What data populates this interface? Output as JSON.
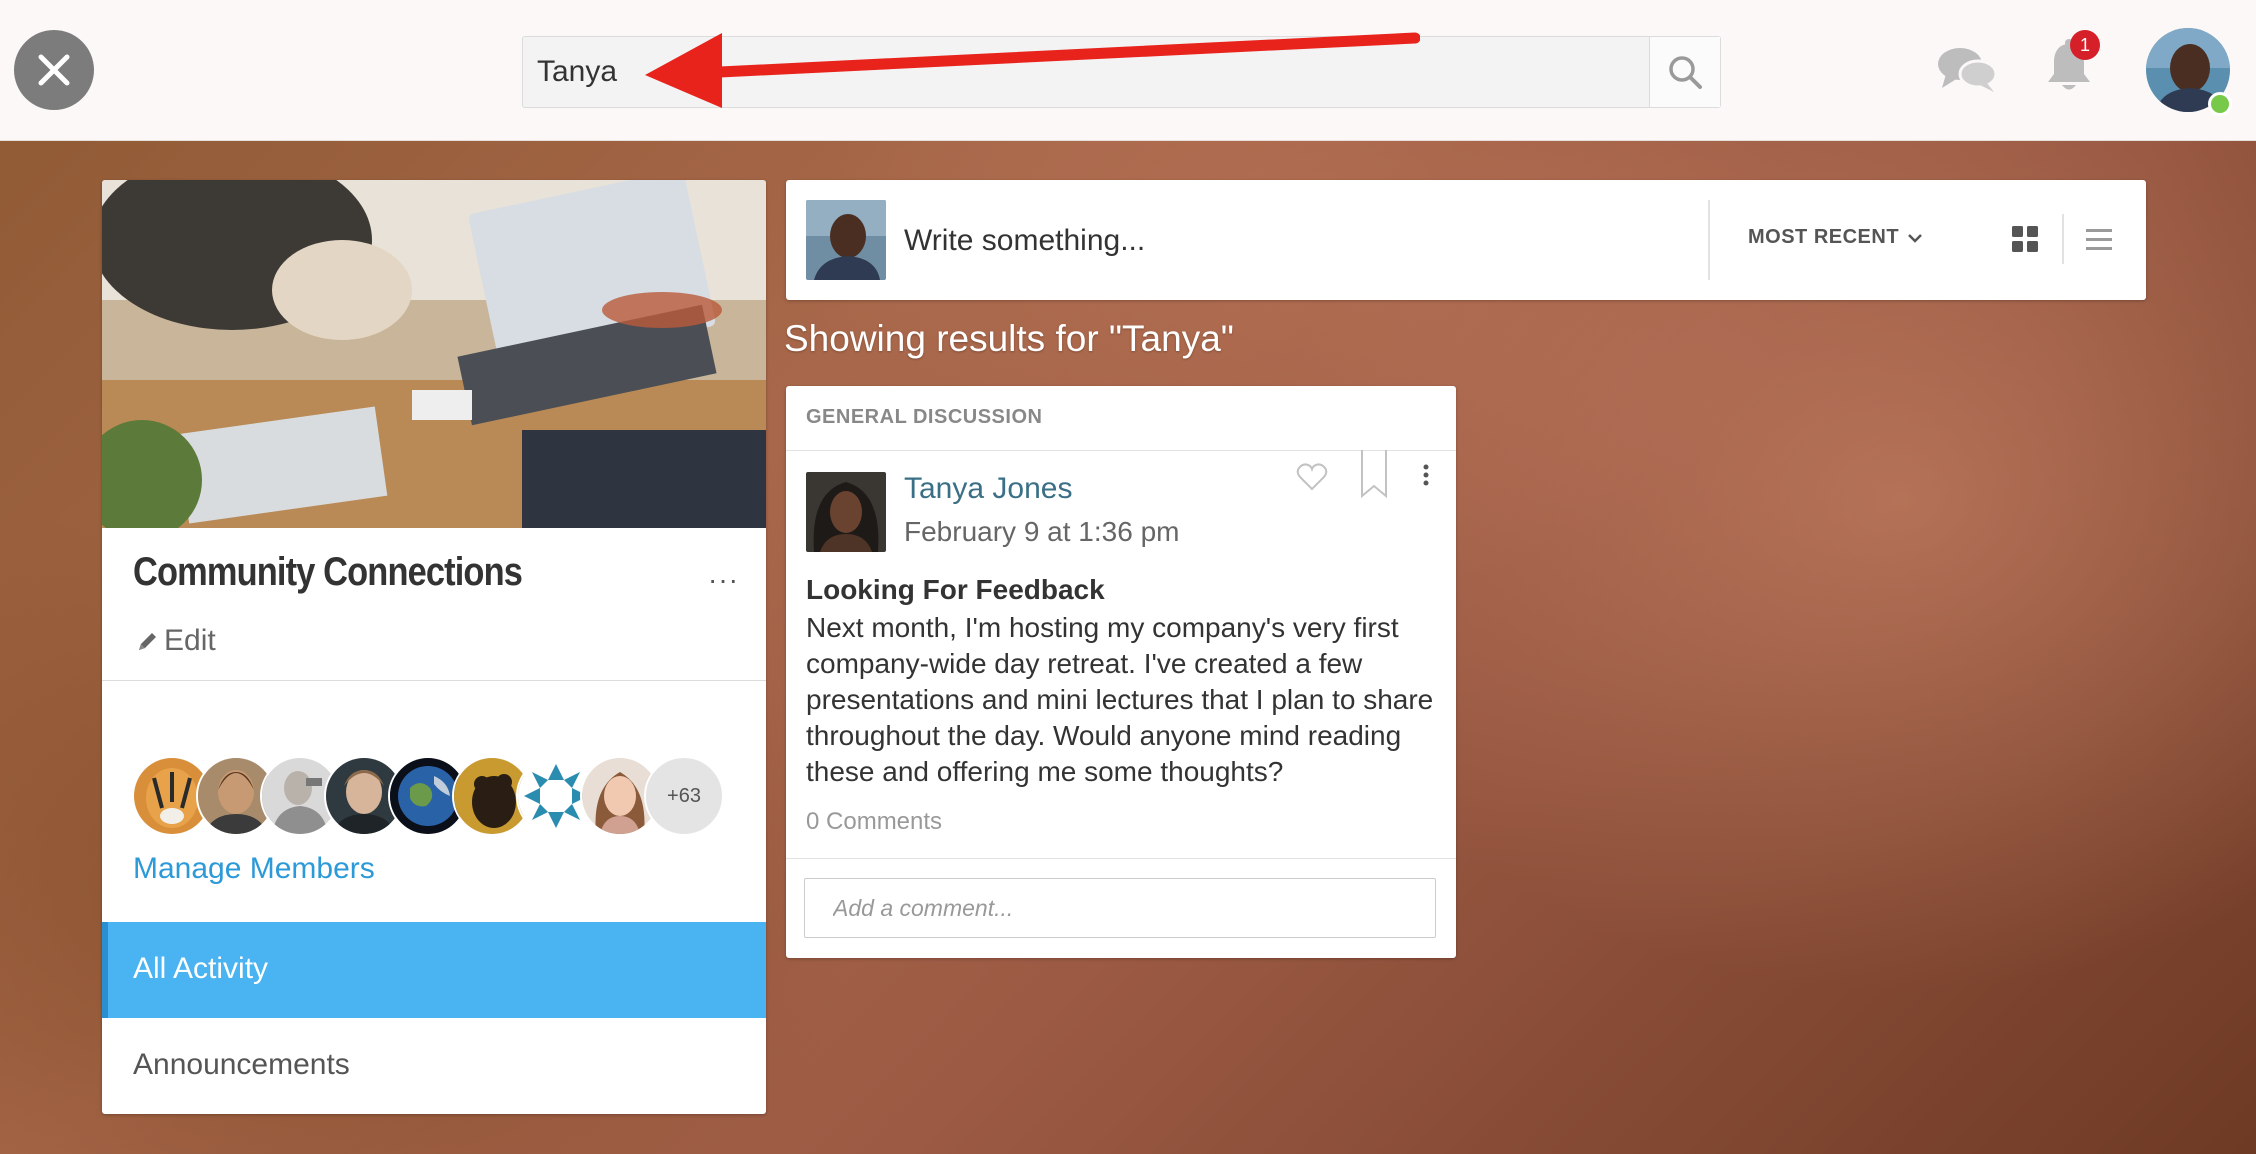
{
  "search": {
    "value": "Tanya"
  },
  "notifications": {
    "count": "1"
  },
  "group": {
    "title": "Community Connections",
    "more": "···",
    "edit_label": "Edit",
    "members_more": "+63",
    "manage_members": "Manage Members"
  },
  "nav": {
    "items": [
      {
        "label": "All Activity",
        "active": true
      },
      {
        "label": "Announcements",
        "active": false
      }
    ]
  },
  "composer": {
    "placeholder": "Write something...",
    "sort_label": "MOST RECENT"
  },
  "results": {
    "heading": "Showing results for \"Tanya\""
  },
  "post": {
    "category": "GENERAL DISCUSSION",
    "author": "Tanya Jones",
    "date": "February 9 at 1:36 pm",
    "title": "Looking For Feedback",
    "body": "Next month, I'm hosting my company's very first company-wide day retreat. I've created a few presentations and mini lectures that I plan to share throughout the day. Would anyone mind reading these and offering me some thoughts?",
    "comments": "0 Comments",
    "comment_placeholder": "Add a comment..."
  },
  "colors": {
    "accent": "#4ab3f1",
    "link": "#2c9ad8",
    "author_link": "#3a6f86",
    "badge": "#d5202a",
    "annotation_arrow": "#e8231c"
  }
}
